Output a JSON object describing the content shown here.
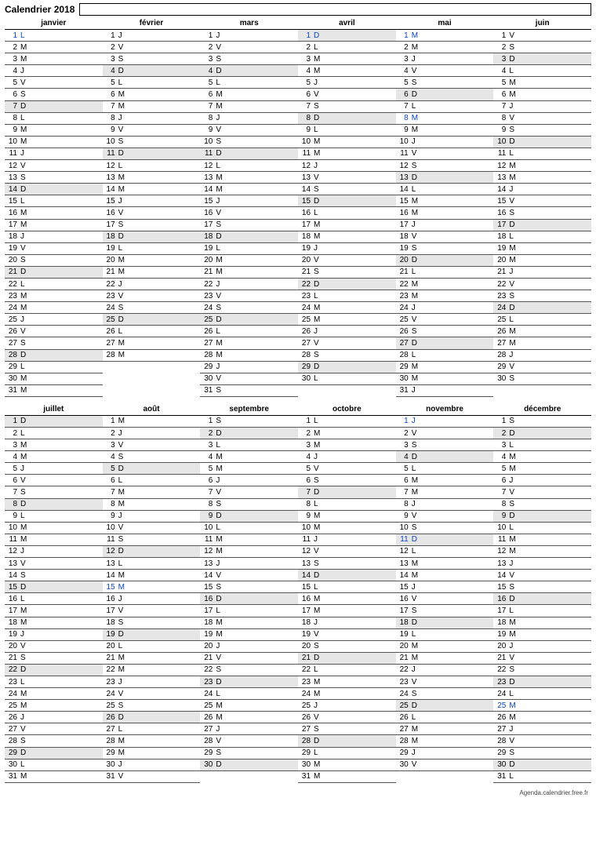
{
  "title": "Calendrier 2018",
  "footer": "Agenda.calendrier.free.fr",
  "dows": [
    "D",
    "L",
    "M",
    "M",
    "J",
    "V",
    "S"
  ],
  "months": [
    {
      "name": "janvier",
      "days": 31,
      "start": 1,
      "holidays": [
        1
      ]
    },
    {
      "name": "février",
      "days": 28,
      "start": 4,
      "holidays": []
    },
    {
      "name": "mars",
      "days": 31,
      "start": 4,
      "holidays": []
    },
    {
      "name": "avril",
      "days": 30,
      "start": 0,
      "holidays": [
        1
      ]
    },
    {
      "name": "mai",
      "days": 31,
      "start": 2,
      "holidays": [
        1,
        8
      ]
    },
    {
      "name": "juin",
      "days": 30,
      "start": 5,
      "holidays": []
    },
    {
      "name": "juillet",
      "days": 31,
      "start": 0,
      "holidays": []
    },
    {
      "name": "août",
      "days": 31,
      "start": 3,
      "holidays": [
        15
      ]
    },
    {
      "name": "septembre",
      "days": 30,
      "start": 6,
      "holidays": []
    },
    {
      "name": "octobre",
      "days": 31,
      "start": 1,
      "holidays": []
    },
    {
      "name": "novembre",
      "days": 30,
      "start": 4,
      "holidays": [
        1,
        11
      ]
    },
    {
      "name": "décembre",
      "days": 31,
      "start": 6,
      "holidays": [
        25
      ]
    }
  ]
}
